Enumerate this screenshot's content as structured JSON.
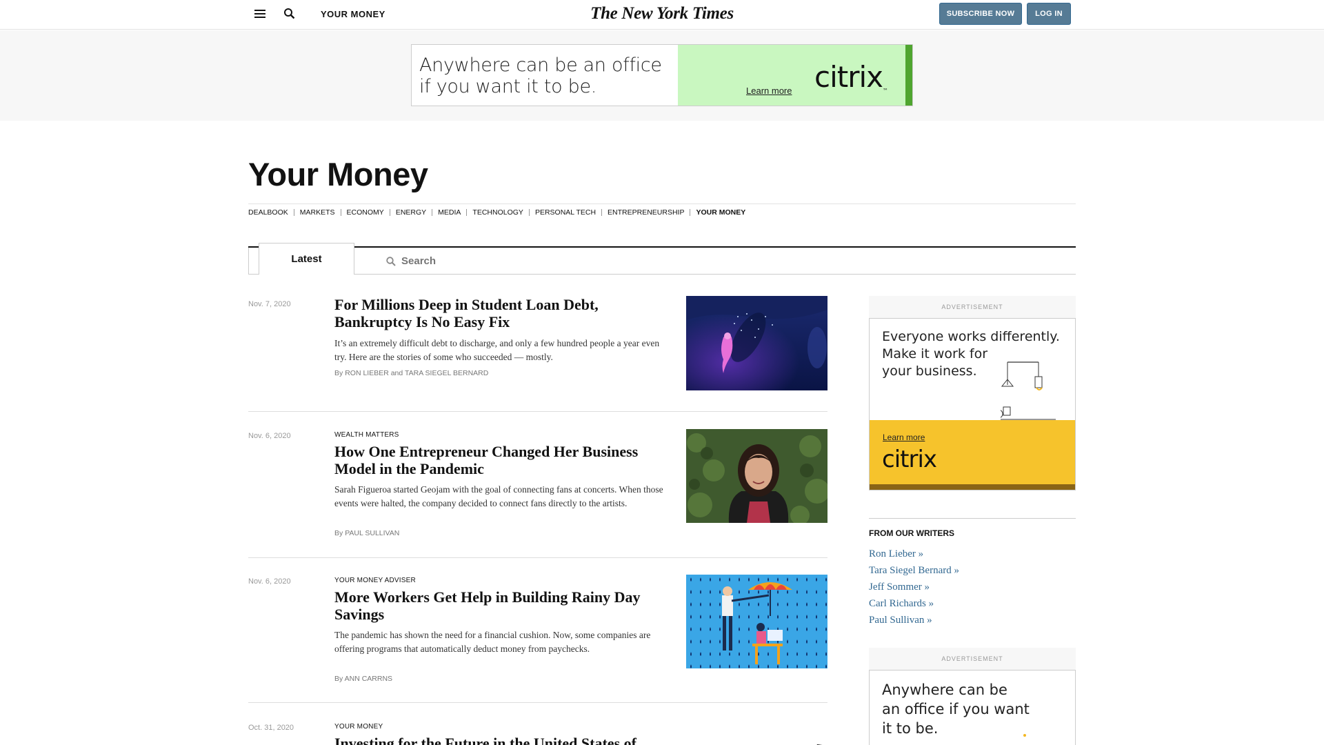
{
  "header": {
    "section_label": "YOUR MONEY",
    "masthead": "The New York Times",
    "subscribe_label": "SUBSCRIBE NOW",
    "login_label": "LOG IN",
    "button_color": "#567b95"
  },
  "top_ad": {
    "headline_line1": "Anywhere can be an office",
    "headline_line2": "if you want it to be.",
    "cta": "Learn more",
    "brand": "citrix",
    "brand_tm": "™",
    "accent": "#c9f7c0"
  },
  "page": {
    "title": "Your Money"
  },
  "subnav": [
    "DEALBOOK",
    "MARKETS",
    "ECONOMY",
    "ENERGY",
    "MEDIA",
    "TECHNOLOGY",
    "PERSONAL TECH",
    "ENTREPRENEURSHIP",
    "YOUR MONEY"
  ],
  "tabs": {
    "latest_label": "Latest",
    "search_placeholder": "Search"
  },
  "articles": [
    {
      "date": "Nov. 7, 2020",
      "kicker": "",
      "title": "For Millions Deep in Student Loan Debt, Bankruptcy Is No Easy Fix",
      "summary": "It’s an extremely difficult debt to discharge, and only a few hundred people a year even try. Here are the stories of some who succeeded — mostly.",
      "by": "By",
      "byline_names": "RON LIEBER",
      "byline_and": "and",
      "byline_names2": "TARA SIEGEL BERNARD"
    },
    {
      "date": "Nov. 6, 2020",
      "kicker": "WEALTH MATTERS",
      "title": "How One Entrepreneur Changed Her Business Model in the Pandemic",
      "summary": "Sarah Figueroa started Geojam with the goal of connecting fans at concerts. When those events were halted, the company decided to connect fans directly to the artists.",
      "by": "By",
      "byline_names": "PAUL SULLIVAN"
    },
    {
      "date": "Nov. 6, 2020",
      "kicker": "YOUR MONEY ADVISER",
      "title": "More Workers Get Help in Building Rainy Day Savings",
      "summary": "The pandemic has shown the need for a financial cushion. Now, some companies are offering programs that automatically deduct money from paychecks.",
      "by": "By",
      "byline_names": "ANN CARRNS"
    },
    {
      "date": "Oct. 31, 2020",
      "kicker": "YOUR MONEY",
      "title": "Investing for the Future in the United States of"
    }
  ],
  "sidebar": {
    "ad_label": "ADVERTISEMENT",
    "ad1_line1": "Everyone works differently.",
    "ad1_line2": "Make it work for",
    "ad1_line3": "your business.",
    "ad1_cta": "Learn more",
    "ad1_brand": "citrix",
    "ad1_yellow": "#f6c32c",
    "writers_heading": "FROM OUR WRITERS",
    "writers": [
      "Ron Lieber »",
      "Tara Siegel Bernard »",
      "Jeff Sommer »",
      "Carl Richards »",
      "Paul Sullivan »"
    ],
    "ad2_line1": "Anywhere can be",
    "ad2_line2": "an office if you want",
    "ad2_line3": "it to be."
  }
}
